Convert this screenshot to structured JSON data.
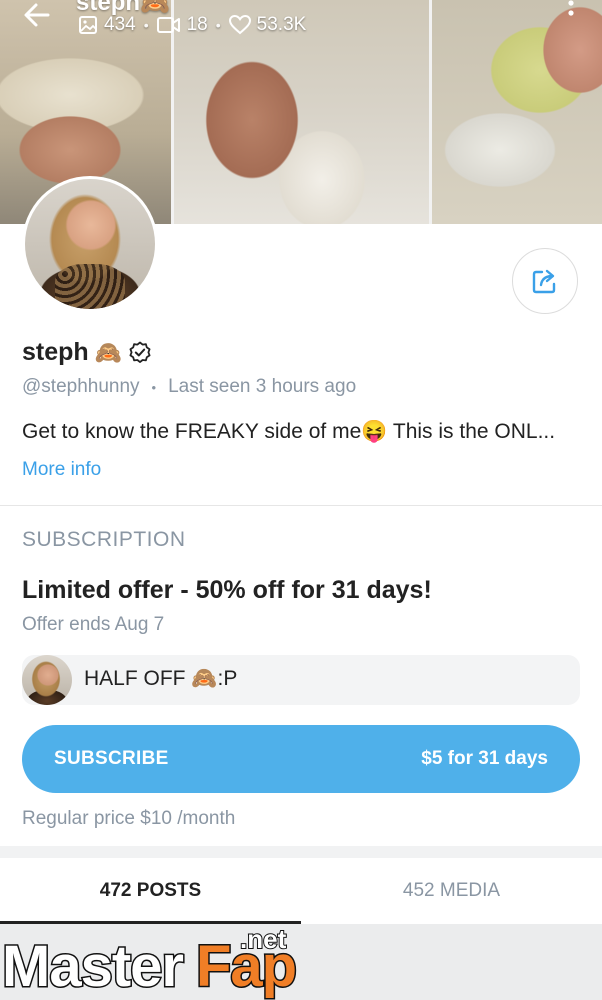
{
  "header": {
    "title_peek": "steph🙈",
    "stats": {
      "photos": "434",
      "videos": "18",
      "likes": "53.3K"
    },
    "separator": "•"
  },
  "profile": {
    "display_name": "steph",
    "name_emoji": "🙈",
    "handle": "@stephhunny",
    "last_seen": "Last seen 3 hours ago",
    "separator": "•",
    "bio": "Get to know the FREAKY side of me😝 This is the ONL...",
    "more_info": "More info"
  },
  "subscription": {
    "section_title": "SUBSCRIPTION",
    "offer_title": "Limited offer - 50% off for 31 days!",
    "offer_ends": "Offer ends Aug 7",
    "promo_message": "HALF OFF 🙈:P",
    "button_label": "SUBSCRIBE",
    "button_price": "$5 for 31 days",
    "regular_price": "Regular price $10 /month"
  },
  "tabs": [
    {
      "label": "472 POSTS",
      "active": true
    },
    {
      "label": "452 MEDIA",
      "active": false
    }
  ],
  "watermark": {
    "brand_part1": "Master",
    "brand_part2": "Fap",
    "suffix": ".net"
  },
  "colors": {
    "accent": "#4fb0ea",
    "link": "#3aa0e8",
    "muted_text": "#8a96a3",
    "watermark_orange": "#f07e26"
  }
}
